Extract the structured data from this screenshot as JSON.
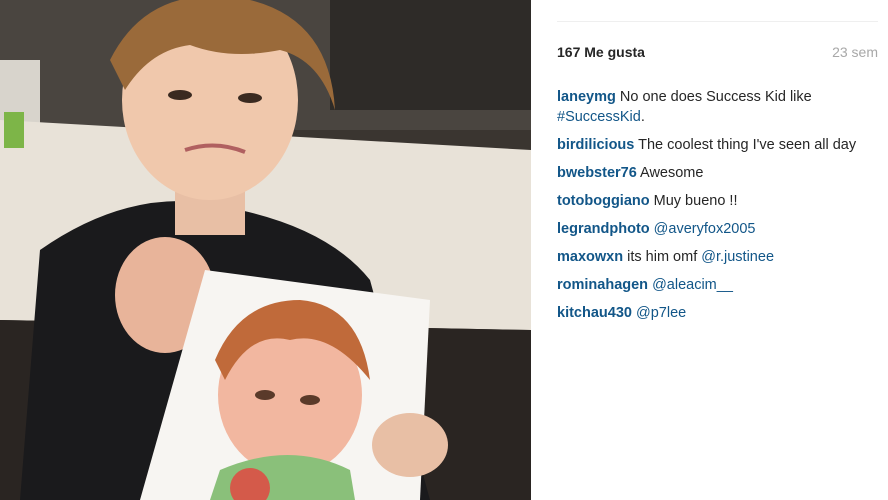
{
  "post": {
    "likes": "167 Me gusta",
    "time": "23 sem"
  },
  "comments": [
    {
      "user": "laneymg",
      "text": "No one does Success Kid like ",
      "tag": "#SuccessKid",
      "suffix": "."
    },
    {
      "user": "birdilicious",
      "text": "The coolest thing I've seen all day",
      "tag": "",
      "suffix": ""
    },
    {
      "user": "bwebster76",
      "text": "Awesome",
      "tag": "",
      "suffix": ""
    },
    {
      "user": "totoboggiano",
      "text": "Muy bueno !!",
      "tag": "",
      "suffix": ""
    },
    {
      "user": "legrandphoto",
      "text": "",
      "tag": "@averyfox2005",
      "suffix": ""
    },
    {
      "user": "maxowxn",
      "text": "its him omf ",
      "tag": "@r.justinee",
      "suffix": ""
    },
    {
      "user": "rominahagen",
      "text": "",
      "tag": "@aleacim__",
      "suffix": ""
    },
    {
      "user": "kitchau430",
      "text": "",
      "tag": "@p7lee",
      "suffix": ""
    }
  ],
  "colors": {
    "username": "#125688",
    "text": "#262626",
    "muted": "#a8a8a8"
  }
}
